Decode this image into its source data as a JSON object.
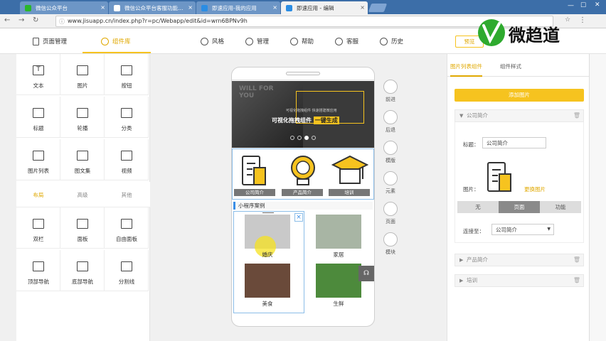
{
  "browser": {
    "tabs": [
      {
        "title": "微信公众平台",
        "color": "#2ab72a"
      },
      {
        "title": "微信公众平台客服功能…",
        "color": "#ffffff"
      },
      {
        "title": "即速应用-我的应用",
        "color": "#2b8de3"
      },
      {
        "title": "即速应用 - 编辑",
        "color": "#2b8de3"
      }
    ],
    "url": "www.jisuapp.cn/index.php?r=pc/Webapp/edit&id=wrn6BPNv9h"
  },
  "header": {
    "page_manage": "页面管理",
    "component_lib": "组件库",
    "style": "风格",
    "manage": "管理",
    "help": "帮助",
    "service": "客服",
    "history": "历史",
    "preview": "预览"
  },
  "watermark": {
    "text": "微趋道",
    "brand_color": "#2eaa2e"
  },
  "components": {
    "basic": [
      "文本",
      "图片",
      "按钮",
      "标题",
      "轮播",
      "分类",
      "图片列表",
      "图文集",
      "视频"
    ],
    "subtabs": [
      "布局",
      "高级",
      "其他"
    ],
    "layout": [
      "双栏",
      "面板",
      "自由面板",
      "顶部导航",
      "底部导航",
      "分割线"
    ]
  },
  "phone": {
    "banner_sub": "可视化拖拽组件 快速搭建微应用",
    "banner_main": "可视化拖拽组件",
    "banner_highlight": "一键生成",
    "banner_bg": "WILL FOR YOU",
    "features": [
      "公司简介",
      "产品简介",
      "培训"
    ],
    "case_title": "小程序案例",
    "cases": [
      "婚庆",
      "家居",
      "美食",
      "生鲜"
    ]
  },
  "tools": [
    "前进",
    "后退",
    "模版",
    "元素",
    "页面",
    "模块"
  ],
  "right": {
    "tabs": [
      "图片列表组件",
      "组件样式"
    ],
    "add_button": "添加图片",
    "sections": [
      "公司简介",
      "产品简介",
      "培训"
    ],
    "title_label": "标题：",
    "title_value": "公司简介",
    "image_label": "图片：",
    "change_image": "更换图片",
    "link_modes": [
      "无",
      "页面",
      "功能"
    ],
    "link_label": "连接至：",
    "link_value": "公司简介"
  },
  "colors": {
    "accent": "#f6c31f",
    "brand_blue": "#3a8ee6"
  }
}
